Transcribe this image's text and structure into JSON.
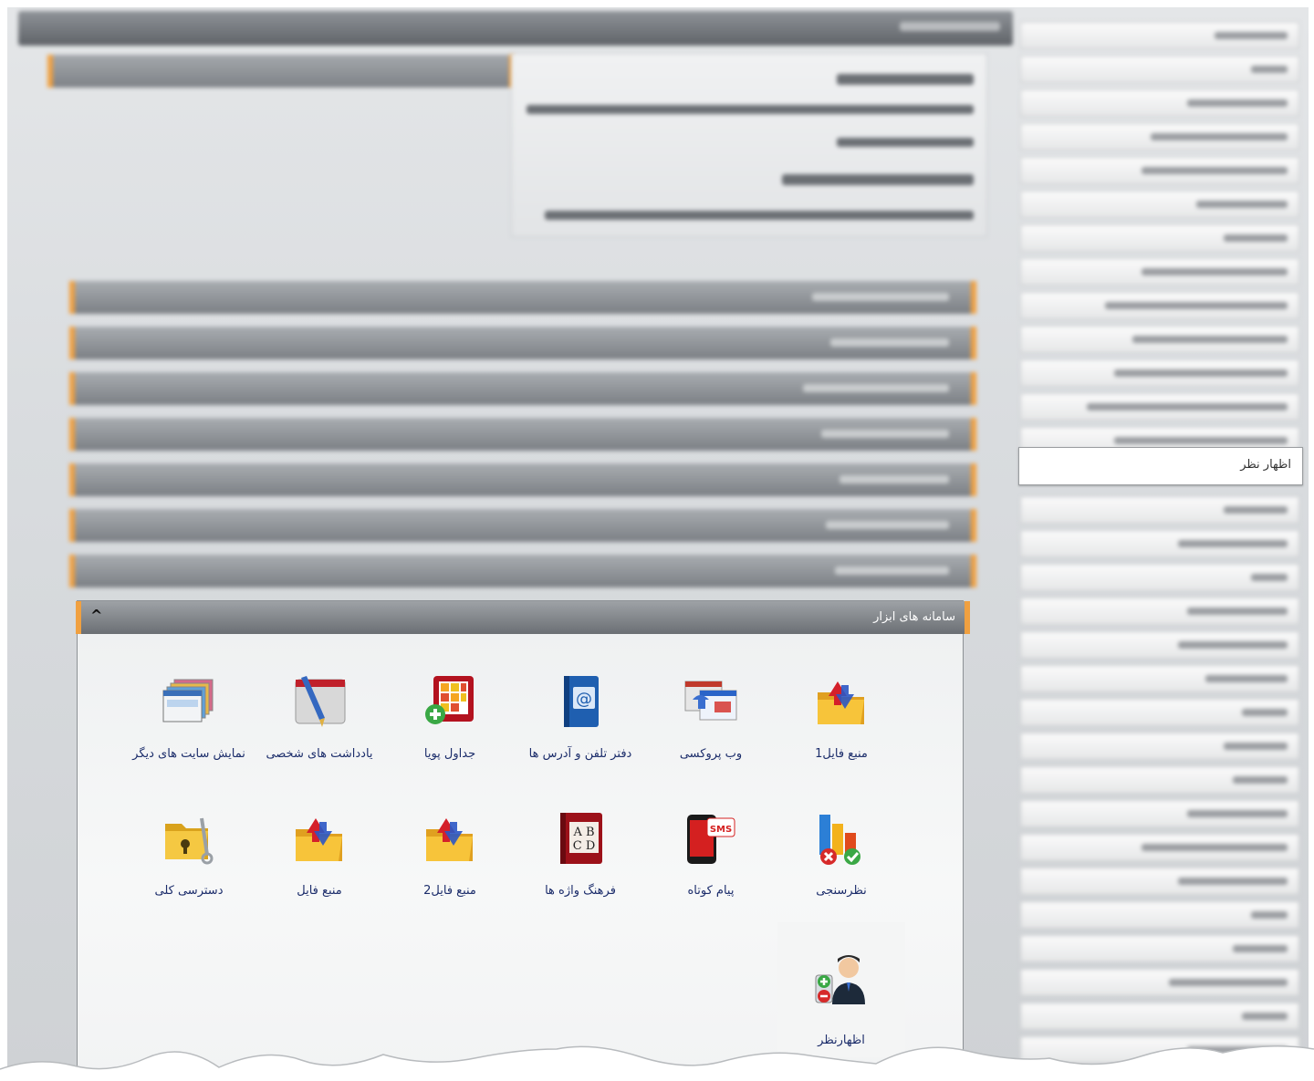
{
  "sidebar": {
    "active_item": "اظهار نظر",
    "blurred_item_count": 30
  },
  "tools_panel": {
    "title": "سامانه های ابزار",
    "collapse_glyph": "^",
    "tiles": [
      {
        "label": "منبع فایل1",
        "icon": "folder-transfer-icon"
      },
      {
        "label": "وب پروکسی",
        "icon": "web-proxy-icon"
      },
      {
        "label": "دفتر تلفن و آدرس ها",
        "icon": "address-book-icon"
      },
      {
        "label": "جداول پویا",
        "icon": "dynamic-table-icon"
      },
      {
        "label": "یادداشت های شخصی",
        "icon": "personal-notes-icon"
      },
      {
        "label": "نمایش سایت های دیگر",
        "icon": "sites-display-icon"
      },
      {
        "label": "نظرسنجی",
        "icon": "poll-chart-icon"
      },
      {
        "label": "پیام کوتاه",
        "icon": "sms-phone-icon"
      },
      {
        "label": "فرهنگ واژه ها",
        "icon": "dictionary-book-icon"
      },
      {
        "label": "منبع فایل2",
        "icon": "folder-transfer-icon"
      },
      {
        "label": "منبع فایل",
        "icon": "folder-transfer-icon"
      },
      {
        "label": "دسترسی کلی",
        "icon": "folder-key-icon"
      },
      {
        "label": "اظهارنظر",
        "icon": "user-opinion-icon"
      }
    ]
  },
  "colors": {
    "accent": "#f0a040",
    "tile_label": "#1c2d6b",
    "header_dark": "#6b6f74"
  }
}
